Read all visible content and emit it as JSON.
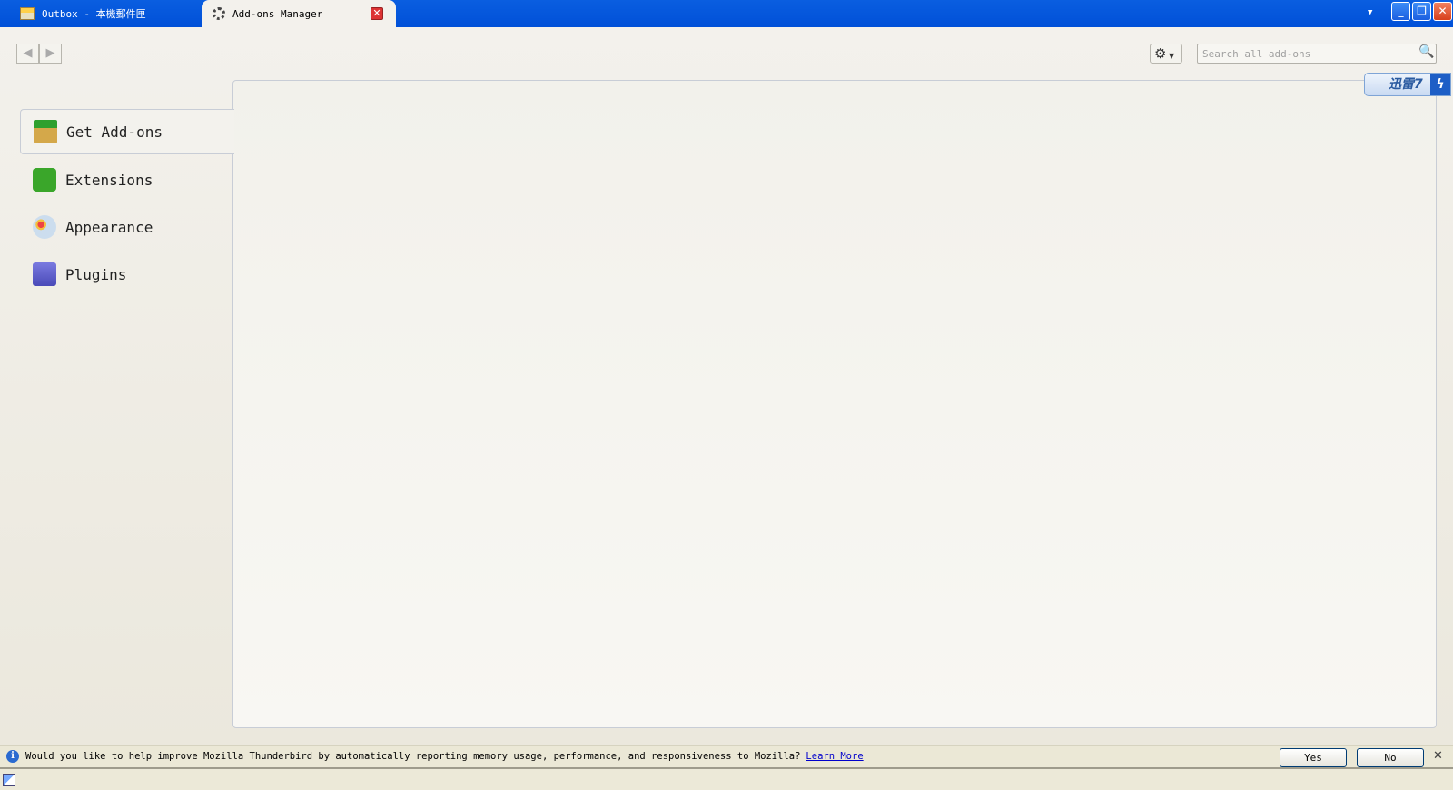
{
  "tabs": [
    {
      "label": "Outbox - 本機郵件匣",
      "icon": "outbox-icon"
    },
    {
      "label": "Add-ons Manager",
      "icon": "loading-spinner-icon",
      "active": true
    }
  ],
  "toolbar": {
    "back_icon": "arrow-left-icon",
    "forward_icon": "arrow-right-icon",
    "tools_icon": "gear-icon",
    "search_placeholder": "Search all add-ons"
  },
  "xunlei": {
    "label": "迅雷7"
  },
  "sidebar": {
    "items": [
      {
        "label": "Get Add-ons",
        "selected": true
      },
      {
        "label": "Extensions"
      },
      {
        "label": "Appearance"
      },
      {
        "label": "Plugins"
      }
    ]
  },
  "notification": {
    "message": "Would you like to help improve Mozilla Thunderbird by automatically reporting memory usage, performance, and responsiveness to Mozilla?",
    "link": "Learn More",
    "yes": "Yes",
    "no": "No"
  }
}
